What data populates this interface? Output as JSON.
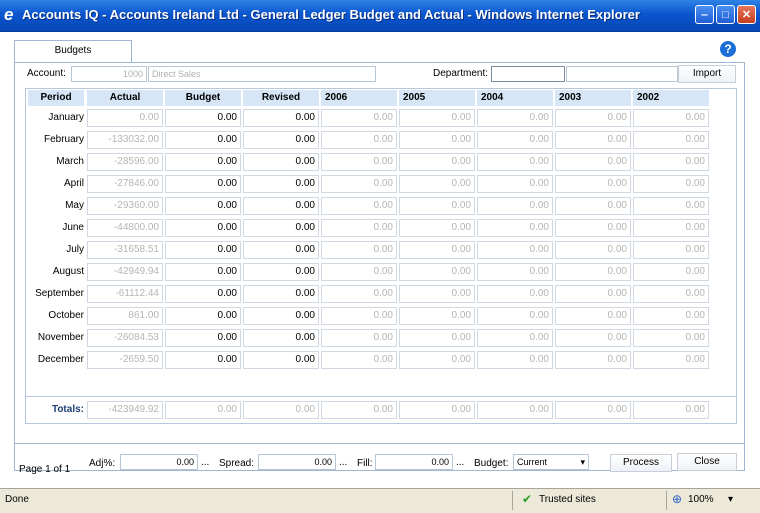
{
  "window": {
    "title": "Accounts IQ - Accounts Ireland Ltd - General Ledger Budget and Actual - Windows Internet Explorer",
    "icon": "ie-icon",
    "min_glyph": "‒",
    "max_glyph": "□",
    "close_glyph": "✕"
  },
  "tab": {
    "label": "Budgets"
  },
  "help_glyph": "?",
  "account": {
    "label": "Account:",
    "code": "1000",
    "name": "Direct Sales"
  },
  "department": {
    "label": "Department:",
    "value1": "",
    "value2": ""
  },
  "import_label": "Import",
  "columns": [
    "Period",
    "Actual",
    "Budget",
    "Revised",
    "2006",
    "2005",
    "2004",
    "2003",
    "2002"
  ],
  "rows": [
    {
      "period": "January",
      "actual": "0.00",
      "budget": "0.00",
      "revised": "0.00"
    },
    {
      "period": "February",
      "actual": "-133032.00",
      "budget": "0.00",
      "revised": "0.00"
    },
    {
      "period": "March",
      "actual": "-28596.00",
      "budget": "0.00",
      "revised": "0.00"
    },
    {
      "period": "April",
      "actual": "-27846.00",
      "budget": "0.00",
      "revised": "0.00"
    },
    {
      "period": "May",
      "actual": "-29360.00",
      "budget": "0.00",
      "revised": "0.00"
    },
    {
      "period": "June",
      "actual": "-44800.00",
      "budget": "0.00",
      "revised": "0.00"
    },
    {
      "period": "July",
      "actual": "-31658.51",
      "budget": "0.00",
      "revised": "0.00"
    },
    {
      "period": "August",
      "actual": "-42949.94",
      "budget": "0.00",
      "revised": "0.00"
    },
    {
      "period": "September",
      "actual": "-61112.44",
      "budget": "0.00",
      "revised": "0.00"
    },
    {
      "period": "October",
      "actual": "861.00",
      "budget": "0.00",
      "revised": "0.00"
    },
    {
      "period": "November",
      "actual": "-26084.53",
      "budget": "0.00",
      "revised": "0.00"
    },
    {
      "period": "December",
      "actual": "-2659.50",
      "budget": "0.00",
      "revised": "0.00"
    }
  ],
  "year_cell_value": "0.00",
  "totals": {
    "label": "Totals:",
    "actual": "-423949.92",
    "budget": "0.00",
    "revised": "0.00",
    "y2006": "0.00",
    "y2005": "0.00",
    "y2004": "0.00",
    "y2003": "0.00",
    "y2002": "0.00"
  },
  "footer": {
    "page": "Page 1 of 1",
    "adj_label": "Adj%:",
    "adj_value": "0.00",
    "spread_label": "Spread:",
    "spread_value": "0.00",
    "fill_label": "Fill:",
    "fill_value": "0.00",
    "ellipsis": "...",
    "budget_label": "Budget:",
    "budget_value": "Current",
    "process_label": "Process",
    "close_label": "Close"
  },
  "statusbar": {
    "status": "Done",
    "zone": "Trusted sites",
    "zoom": "100%",
    "check_glyph": "✔",
    "zoom_glyph": "⊕",
    "dropdown_glyph": "▾"
  },
  "colors": {
    "titlebar": "#0a55cf",
    "header_row": "#d6e6f6",
    "statusbar": "#ece9d8"
  }
}
